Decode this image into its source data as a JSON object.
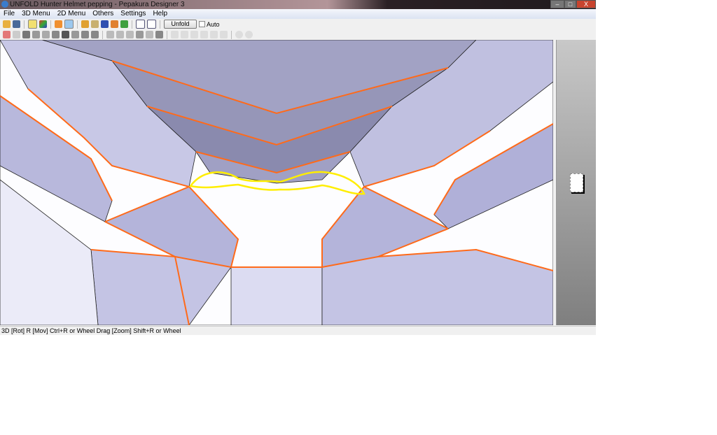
{
  "window": {
    "title": "UNFOLD Hunter Helmet pepping - Pepakura Designer 3",
    "minimize": "–",
    "maximize": "□",
    "close": "X"
  },
  "menu": [
    "File",
    "3D Menu",
    "2D Menu",
    "Others",
    "Settings",
    "Help"
  ],
  "toolbar": {
    "unfold_label": "Unfold",
    "auto_label": "Auto"
  },
  "status": "3D [Rot] R [Mov] Ctrl+R or Wheel Drag [Zoom] Shift+R or Wheel",
  "colors": {
    "face": "#b8b8dc",
    "dark_face": "#8f8fb3",
    "edge": "#ff6a1a",
    "highlight": "#ffee00"
  }
}
